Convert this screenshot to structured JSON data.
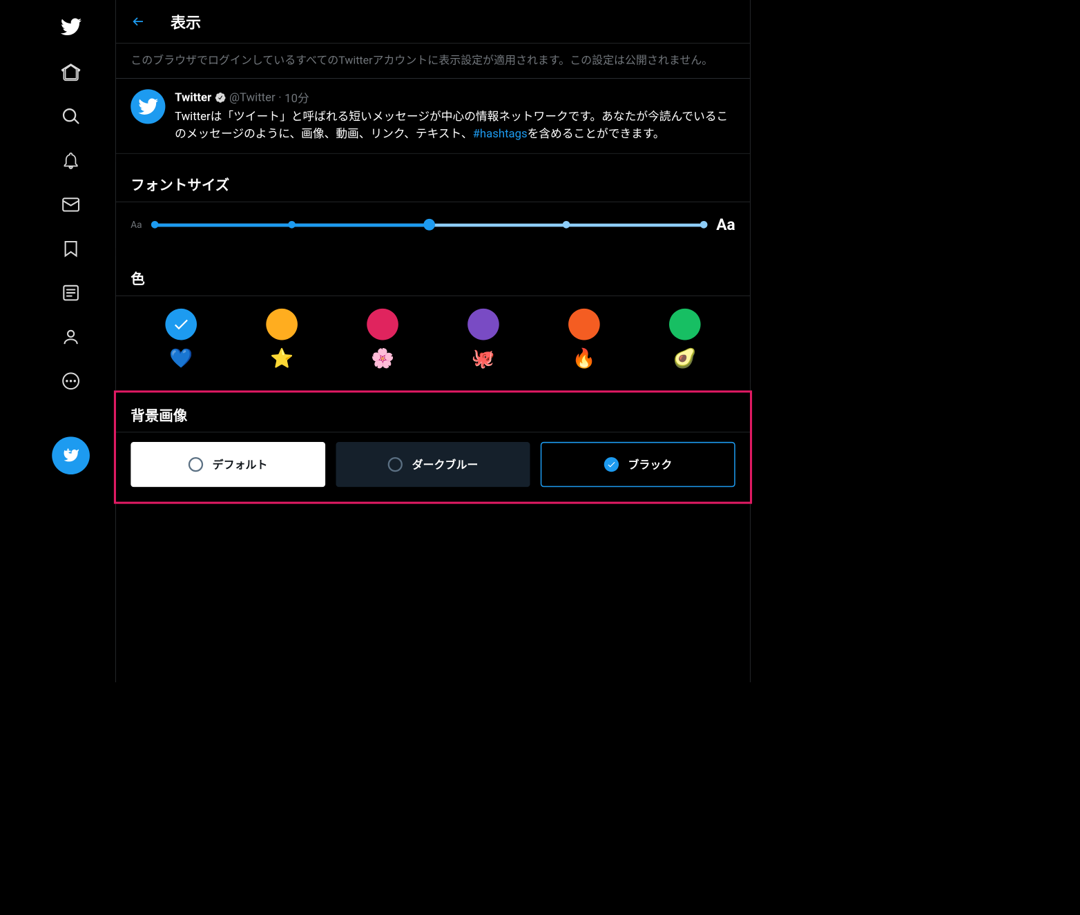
{
  "header": {
    "title": "表示"
  },
  "description": "このブラウザでログインしているすべてのTwitterアカウントに表示設定が適用されます。この設定は公開されません。",
  "sample_tweet": {
    "name": "Twitter",
    "handle": "@Twitter",
    "time": "10分",
    "text_before": "Twitterは「ツイート」と呼ばれる短いメッセージが中心の情報ネットワークです。あなたが今読んでいるこのメッセージのように、画像、動画、リンク、テキスト、",
    "hashtag": "#hashtags",
    "text_after": "を含めることができます。"
  },
  "sections": {
    "fontsize": "フォントサイズ",
    "color": "色",
    "background": "背景画像"
  },
  "fontsize_small": "Aa",
  "fontsize_large": "Aa",
  "colors": [
    {
      "hex": "#1d9bf0",
      "emoji": "💙",
      "selected": true
    },
    {
      "hex": "#ffad1f",
      "emoji": "⭐",
      "selected": false
    },
    {
      "hex": "#e0245e",
      "emoji": "🌸",
      "selected": false
    },
    {
      "hex": "#794bc4",
      "emoji": "🐙",
      "selected": false
    },
    {
      "hex": "#f45d22",
      "emoji": "🔥",
      "selected": false
    },
    {
      "hex": "#17bf63",
      "emoji": "🥑",
      "selected": false
    }
  ],
  "backgrounds": {
    "default": "デフォルト",
    "dim": "ダークブルー",
    "black": "ブラック"
  }
}
